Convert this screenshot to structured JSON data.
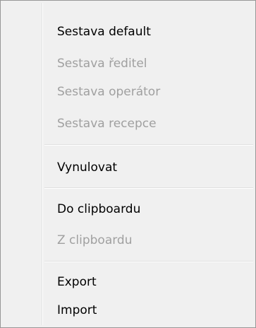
{
  "context_menu": {
    "groups": [
      [
        {
          "label": "Sestava default",
          "enabled": true
        },
        {
          "label": "Sestava ředitel",
          "enabled": false
        },
        {
          "label": "Sestava operátor",
          "enabled": false
        },
        {
          "label": "Sestava recepce",
          "enabled": false
        }
      ],
      [
        {
          "label": "Vynulovat",
          "enabled": true
        }
      ],
      [
        {
          "label": "Do clipboardu",
          "enabled": true
        },
        {
          "label": "Z clipboardu",
          "enabled": false
        }
      ],
      [
        {
          "label": "Export",
          "enabled": true
        },
        {
          "label": "Import",
          "enabled": true
        }
      ]
    ],
    "colors": {
      "background": "#f0f0f0",
      "border": "#979797",
      "text": "#000000",
      "disabled_text": "#a0a0a0"
    }
  }
}
